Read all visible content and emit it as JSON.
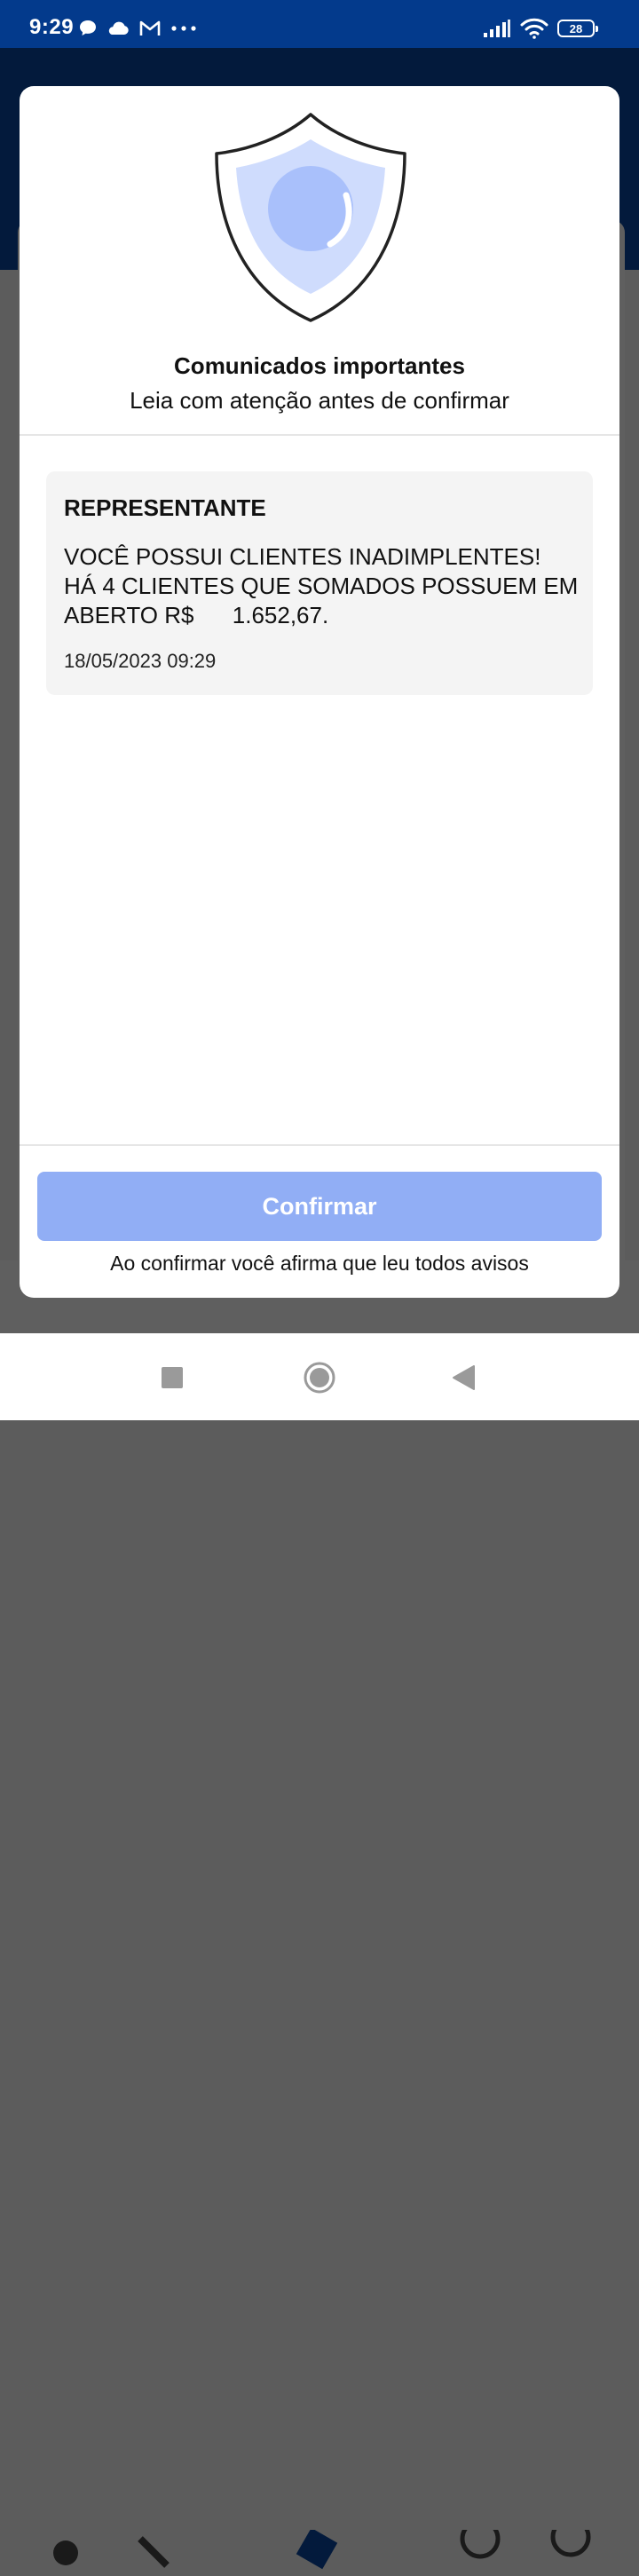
{
  "status_bar": {
    "time": "9:29",
    "battery": "28",
    "left_icons": [
      "chat-bubble-icon",
      "cloud-icon",
      "gmail-icon",
      "more-dots-icon"
    ],
    "right_icons": [
      "signal-icon",
      "wifi-icon",
      "battery-icon"
    ]
  },
  "modal": {
    "title": "Comunicados importantes",
    "subtitle": "Leia com atenção antes de confirmar",
    "notice": {
      "title": "REPRESENTANTE",
      "body": "VOCÊ POSSUI CLIENTES INADIMPLENTES! HÁ 4 CLIENTES QUE SOMADOS POSSUEM EM ABERTO R$      1.652,67.",
      "date": "18/05/2023 09:29"
    },
    "confirm_label": "Confirmar",
    "footnote": "Ao confirmar você afirma que leu todos avisos"
  },
  "colors": {
    "status_bar": "#033a8c",
    "app_header": "#031a3c",
    "confirm_button": "#91aef5",
    "shield_inner": "#cfdcfd",
    "shield_circle": "#a9c0fb"
  }
}
